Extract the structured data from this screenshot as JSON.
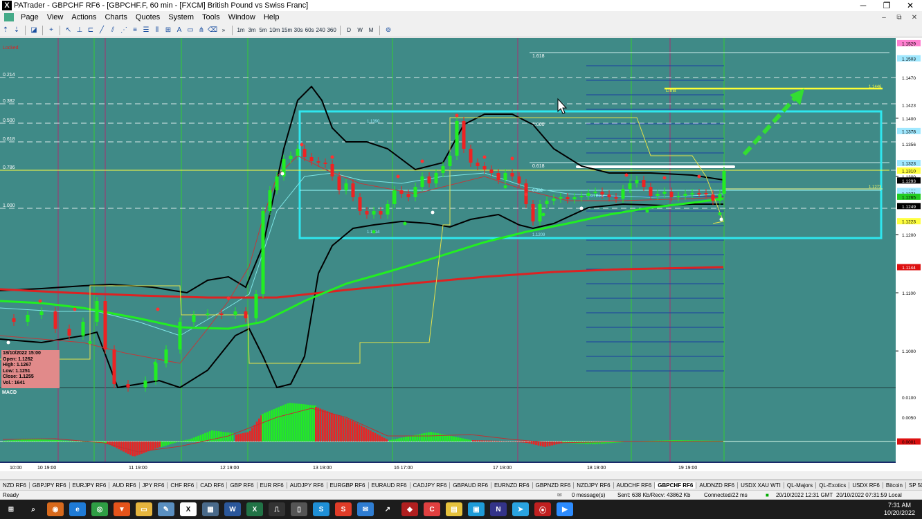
{
  "window": {
    "title": "PATrader - GBPCHF RF6 - [GBPCHF.F, 60 min - [FXCM] British Pound vs Swiss Franc]",
    "app_icon_glyph": "X",
    "min": "─",
    "max": "❐",
    "close": "✕"
  },
  "menu": [
    "Page",
    "View",
    "Actions",
    "Charts",
    "Quotes",
    "System",
    "Tools",
    "Window",
    "Help"
  ],
  "mdi_buttons": [
    "‒",
    "⧉",
    "✕"
  ],
  "toolbar": {
    "timeframes": [
      "1m",
      "3m",
      "5m",
      "10m",
      "15m",
      "30s",
      "60s",
      "240",
      "360"
    ],
    "periods": [
      "D",
      "W",
      "M"
    ],
    "chevron": "»"
  },
  "chart": {
    "locked_label": "Locked",
    "fib_left_labels": [
      "0.214",
      "0.382",
      "0.500",
      "0.618",
      "0.786",
      "1.000"
    ],
    "fib_right_labels": [
      "1.618",
      "1.000",
      "0.618"
    ],
    "fib_right_level_text": "0.382",
    "peak_label": "1.1390",
    "low_label_left": "1.1214",
    "low_label_right": "1.1209",
    "limit_label": "Limit",
    "limit_price_label": "1.1446",
    "cluster_label": "Cisd Bear",
    "small_level_label": "1.1273",
    "macd_label": "MACD",
    "price_axis": [
      {
        "label": "1.1529",
        "color": "#ff7fd0",
        "text": "#000"
      },
      {
        "label": "1.1503",
        "color": "#a0e8ff",
        "text": "#000"
      },
      {
        "label": "1.1470",
        "color": "#ffffff",
        "text": "#000"
      },
      {
        "label": "1.1423",
        "color": "#ffffff",
        "text": "#000"
      },
      {
        "label": "1.1400",
        "color": null,
        "text": "#000"
      },
      {
        "label": "1.1378",
        "color": "#a0e8ff",
        "text": "#000"
      },
      {
        "label": "1.1356",
        "color": "#ffffff",
        "text": "#000"
      },
      {
        "label": "1.1323",
        "color": "#a0e8ff",
        "text": "#000"
      },
      {
        "label": "1.1310",
        "color": "#ffff40",
        "text": "#000"
      },
      {
        "label": "1.1300",
        "color": null,
        "text": "#000"
      },
      {
        "label": "1.1293",
        "color": "#000000",
        "text": "#fff"
      },
      {
        "label": "1.1275",
        "color": "#a0e8ff",
        "text": "#000"
      },
      {
        "label": "1.1271",
        "color": "#a0e8ff",
        "text": "#000"
      },
      {
        "label": "1.1265",
        "color": "#22cc22",
        "text": "#000"
      },
      {
        "label": "1.1249",
        "color": "#000000",
        "text": "#fff"
      },
      {
        "label": "1.1223",
        "color": "#ffff40",
        "text": "#000"
      },
      {
        "label": "1.1200",
        "color": null,
        "text": "#000"
      },
      {
        "label": "1.1144",
        "color": "#dd1111",
        "text": "#fff"
      },
      {
        "label": "1.1100",
        "color": null,
        "text": "#000"
      },
      {
        "label": "1.1000",
        "color": null,
        "text": "#000"
      }
    ],
    "macd_axis": [
      {
        "label": "0.0100",
        "color": null
      },
      {
        "label": "0.0050",
        "color": null
      },
      {
        "label": "0.0001",
        "color": "#dd1111"
      }
    ],
    "time_axis": [
      "10:00",
      "10 19:00",
      "11 19:00",
      "12 19:00",
      "13 19:00",
      "16 17:00",
      "17 19:00",
      "18 19:00",
      "19 19:00"
    ],
    "info": {
      "date": "18/10/2022 15:00",
      "open": "Open: 1.1262",
      "high": "High: 1.1267",
      "low": "Low: 1.1251",
      "close": "Close: 1.1255",
      "vol": "Vol.: 1641"
    },
    "colors": {
      "background": "#3f8a87",
      "box": "#2fe6ee",
      "ma_green": "#22ee22",
      "ma_red": "#dd2222",
      "limit": "#ffff33",
      "arrow": "#33dd33"
    }
  },
  "symbols": [
    "NZD RF6",
    "GBPJPY RF6",
    "EURJPY RF6",
    "AUD RF6",
    "JPY RF6",
    "CHF RF6",
    "CAD RF6",
    "GBP RF6",
    "EUR RF6",
    "AUDJPY RF6",
    "EURGBP RF6",
    "EURAUD RF6",
    "CADJPY RF6",
    "GBPAUD RF6",
    "EURNZD RF6",
    "GBPNZD RF6",
    "NZDJPY RF6",
    "AUDCHF RF6",
    "GBPCHF RF6",
    "AUDNZD RF6",
    "USDX XAU WTI",
    "QL-Majors",
    "QL-Exotics",
    "USDX RF6",
    "Bitcoin",
    "SP 500"
  ],
  "active_symbol": "GBPCHF RF6",
  "status": {
    "left": "Ready",
    "messages": "0 message(s)",
    "traffic": "Sent: 638 Kb/Recv: 43862 Kb",
    "conn": "Connected/22 ms",
    "gmt": "20/10/2022 12:31 GMT",
    "local": "20/10/2022 07:31:59 Local"
  },
  "taskbar": {
    "time": "7:31 AM",
    "date": "10/20/2022",
    "apps": [
      {
        "icon": "windows-icon",
        "glyph": "⊞",
        "color": "#1c1c1c"
      },
      {
        "icon": "search-icon",
        "glyph": "⌕",
        "color": "#1c1c1c"
      },
      {
        "icon": "app-orange-icon",
        "glyph": "◉",
        "color": "#d76a1d"
      },
      {
        "icon": "edge-icon",
        "glyph": "e",
        "color": "#1f7bd6"
      },
      {
        "icon": "chrome-icon",
        "glyph": "◎",
        "color": "#2f9e44"
      },
      {
        "icon": "brave-icon",
        "glyph": "▼",
        "color": "#e5541b"
      },
      {
        "icon": "folder-icon",
        "glyph": "▭",
        "color": "#e6b53d"
      },
      {
        "icon": "notepad-icon",
        "glyph": "✎",
        "color": "#5a8fc0"
      },
      {
        "icon": "patrader-icon",
        "glyph": "X",
        "color": "#ffffff"
      },
      {
        "icon": "calc-icon",
        "glyph": "▦",
        "color": "#4a6a8a"
      },
      {
        "icon": "word-icon",
        "glyph": "W",
        "color": "#2b579a"
      },
      {
        "icon": "excel-icon",
        "glyph": "X",
        "color": "#217346"
      },
      {
        "icon": "chart-app-icon",
        "glyph": "⎍",
        "color": "#333333"
      },
      {
        "icon": "tablet-icon",
        "glyph": "▯",
        "color": "#555555"
      },
      {
        "icon": "app-s-icon",
        "glyph": "S",
        "color": "#1f8fd6"
      },
      {
        "icon": "app-s2-icon",
        "glyph": "S",
        "color": "#e03c28"
      },
      {
        "icon": "mail-icon",
        "glyph": "✉",
        "color": "#2f7dd2"
      },
      {
        "icon": "tradingview-icon",
        "glyph": "↗",
        "color": "#1c1c1c"
      },
      {
        "icon": "app-red-icon",
        "glyph": "◆",
        "color": "#b02020"
      },
      {
        "icon": "app-c-icon",
        "glyph": "C",
        "color": "#e04040"
      },
      {
        "icon": "notes-icon",
        "glyph": "▤",
        "color": "#e6c23d"
      },
      {
        "icon": "store-icon",
        "glyph": "▣",
        "color": "#1e9bd7"
      },
      {
        "icon": "app-n-icon",
        "glyph": "N",
        "color": "#333388"
      },
      {
        "icon": "telegram-icon",
        "glyph": "➤",
        "color": "#2aa3e0"
      },
      {
        "icon": "record-icon",
        "glyph": "⦿",
        "color": "#c02020"
      },
      {
        "icon": "zoom-icon",
        "glyph": "▶",
        "color": "#2d8cff"
      }
    ]
  }
}
